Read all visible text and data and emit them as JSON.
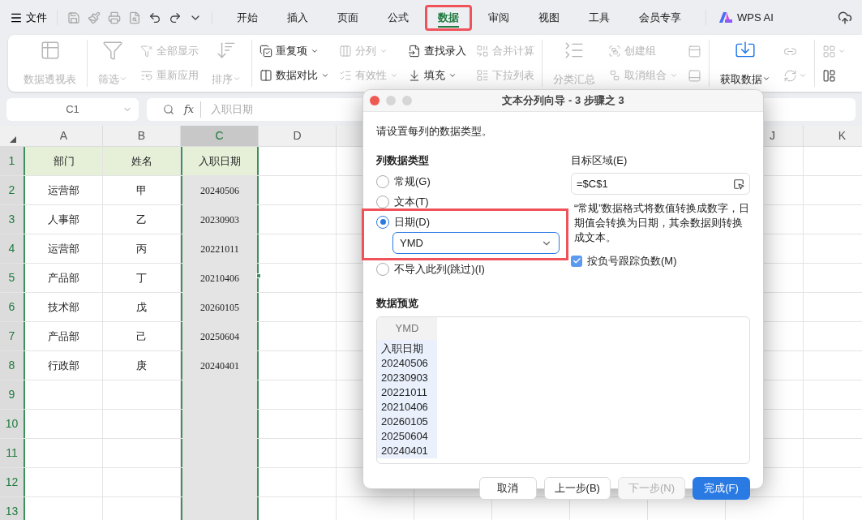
{
  "toolbar": {
    "file_menu": "文件"
  },
  "tabs": [
    {
      "label": "开始",
      "selected": false,
      "highlighted": false
    },
    {
      "label": "插入",
      "selected": false,
      "highlighted": false
    },
    {
      "label": "页面",
      "selected": false,
      "highlighted": false
    },
    {
      "label": "公式",
      "selected": false,
      "highlighted": false
    },
    {
      "label": "数据",
      "selected": true,
      "highlighted": true
    },
    {
      "label": "审阅",
      "selected": false,
      "highlighted": false
    },
    {
      "label": "视图",
      "selected": false,
      "highlighted": false
    },
    {
      "label": "工具",
      "selected": false,
      "highlighted": false
    },
    {
      "label": "会员专享",
      "selected": false,
      "highlighted": false
    }
  ],
  "ai_button": "WPS AI",
  "ribbon": {
    "groups": [
      [
        [
          {
            "kind": "large",
            "label": "数据透视表",
            "disabled": true,
            "dropdown": false
          }
        ]
      ],
      [
        [
          {
            "kind": "large",
            "label": "筛选",
            "disabled": true,
            "dropdown": true
          }
        ],
        [
          {
            "kind": "small",
            "label": "全部显示",
            "disabled": true,
            "dropdown": false
          },
          {
            "kind": "small",
            "label": "重新应用",
            "disabled": true,
            "dropdown": false
          }
        ],
        [
          {
            "kind": "large",
            "label": "排序",
            "disabled": true,
            "dropdown": true
          }
        ]
      ],
      [
        [
          {
            "kind": "small",
            "label": "重复项",
            "disabled": false,
            "dropdown": true
          },
          {
            "kind": "small",
            "label": "数据对比",
            "disabled": false,
            "dropdown": true
          }
        ],
        [
          {
            "kind": "small",
            "label": "分列",
            "disabled": true,
            "dropdown": true
          },
          {
            "kind": "small",
            "label": "有效性",
            "disabled": true,
            "dropdown": true
          }
        ],
        [
          {
            "kind": "small",
            "label": "查找录入",
            "disabled": false,
            "dropdown": false
          },
          {
            "kind": "small",
            "label": "填充",
            "disabled": false,
            "dropdown": true
          }
        ],
        [
          {
            "kind": "small",
            "label": "合并计算",
            "disabled": true,
            "dropdown": false
          },
          {
            "kind": "small",
            "label": "下拉列表",
            "disabled": true,
            "dropdown": false
          }
        ]
      ],
      [
        [
          {
            "kind": "large",
            "label": "分类汇总",
            "disabled": true,
            "dropdown": false
          }
        ],
        [
          {
            "kind": "small",
            "label": "创建组",
            "disabled": true,
            "dropdown": false
          },
          {
            "kind": "small",
            "label": "取消组合",
            "disabled": true,
            "dropdown": true
          }
        ],
        [
          {
            "kind": "icon",
            "disabled": true,
            "dropdown": false
          },
          {
            "kind": "icon",
            "disabled": true,
            "dropdown": false
          }
        ]
      ],
      [
        [
          {
            "kind": "large",
            "label": "获取数据",
            "disabled": false,
            "dropdown": true
          }
        ],
        [
          {
            "kind": "icon",
            "disabled": true,
            "dropdown": false
          },
          {
            "kind": "icon",
            "disabled": true,
            "dropdown": true
          }
        ]
      ],
      [
        [
          {
            "kind": "icon",
            "disabled": true,
            "dropdown": true
          },
          {
            "kind": "icon",
            "disabled": false,
            "dropdown": false
          }
        ]
      ]
    ]
  },
  "formula_bar": {
    "name_box": "C1",
    "fx": "fx",
    "content": "入职日期"
  },
  "sheet": {
    "left_columns": [
      {
        "letter": "A",
        "selected": false
      },
      {
        "letter": "B",
        "selected": false
      },
      {
        "letter": "C",
        "selected": true
      },
      {
        "letter": "D",
        "selected": false
      }
    ],
    "right_columns": [
      {
        "letter": "J",
        "selected": false
      },
      {
        "letter": "K",
        "selected": false
      }
    ],
    "row_numbers": [
      "1",
      "2",
      "3",
      "4",
      "5",
      "6",
      "7",
      "8",
      "9",
      "10",
      "11",
      "12",
      "13"
    ],
    "header_row": [
      "部门",
      "姓名",
      "入职日期"
    ],
    "rows": [
      [
        "运营部",
        "甲",
        "20240506"
      ],
      [
        "人事部",
        "乙",
        "20230903"
      ],
      [
        "运营部",
        "丙",
        "20221011"
      ],
      [
        "产品部",
        "丁",
        "20210406"
      ],
      [
        "技术部",
        "戊",
        "20260105"
      ],
      [
        "产品部",
        "己",
        "20250604"
      ],
      [
        "行政部",
        "庚",
        "20240401"
      ]
    ]
  },
  "dialog": {
    "title": "文本分列向导 - 3 步骤之 3",
    "instruction": "请设置每列的数据类型。",
    "column_type_heading": "列数据类型",
    "options": [
      {
        "label": "常规(G)",
        "selected": false,
        "highlighted": false
      },
      {
        "label": "文本(T)",
        "selected": false,
        "highlighted": false
      },
      {
        "label": "日期(D)",
        "selected": true,
        "highlighted": true,
        "format": "YMD"
      },
      {
        "label": "不导入此列(跳过)(I)",
        "selected": false,
        "highlighted": false
      }
    ],
    "target_label": "目标区域(E)",
    "target_value": "=$C$1",
    "description": "“常规”数据格式将数值转换成数字，日期值会转换为日期，其余数据则转换成文本。",
    "negative_checkbox": {
      "label": "按负号跟踪负数(M)",
      "checked": true
    },
    "preview_heading": "数据预览",
    "preview": {
      "column_header": "YMD",
      "values": [
        "入职日期",
        "20240506",
        "20230903",
        "20221011",
        "20210406",
        "20260105",
        "20250604",
        "20240401"
      ]
    },
    "buttons": [
      {
        "label": "取消",
        "kind": "normal",
        "disabled": false
      },
      {
        "label": "上一步(B)",
        "kind": "normal",
        "disabled": false
      },
      {
        "label": "下一步(N)",
        "kind": "normal",
        "disabled": true
      },
      {
        "label": "完成(F)",
        "kind": "primary",
        "disabled": false
      }
    ]
  }
}
